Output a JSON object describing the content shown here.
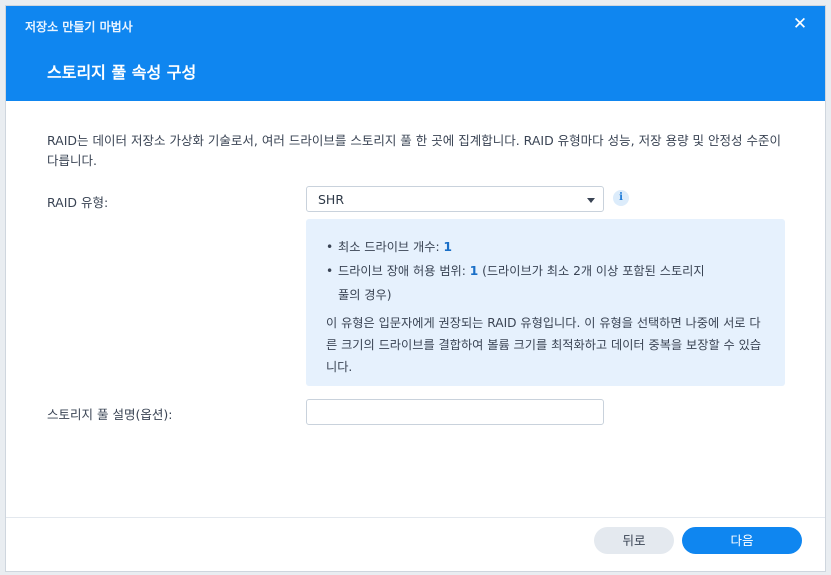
{
  "window": {
    "title": "저장소 만들기 마법사",
    "close_icon": "close-icon"
  },
  "header": {
    "step_title": "스토리지 풀 속성 구성"
  },
  "description": "RAID는 데이터 저장소 가상화 기술로서, 여러 드라이브를 스토리지 풀 한 곳에 집계합니다. RAID 유형마다 성능, 저장 용량 및 안정성 수준이 다릅니다.",
  "raid_type": {
    "label": "RAID 유형:",
    "selected": "SHR",
    "info_icon": "info-icon"
  },
  "info": {
    "min_drives_label": "최소 드라이브 개수: ",
    "min_drives_value": "1",
    "fault_tolerance_label": "드라이브 장애 허용 범위: ",
    "fault_tolerance_value": "1",
    "fault_tolerance_note_line1": " (드라이브가 최소 2개 이상 포함된 스토리지",
    "fault_tolerance_note_line2": "풀의 경우)",
    "paragraph": "이 유형은 입문자에게 권장되는 RAID 유형입니다. 이 유형을 선택하면 나중에 서로 다른 크기의 드라이브를 결합하여 볼륨 크기를 최적화하고 데이터 중복을 보장할 수 있습니다."
  },
  "pool_description": {
    "label": "스토리지 풀 설명(옵션):",
    "value": "",
    "placeholder": ""
  },
  "footer": {
    "back_label": "뒤로",
    "next_label": "다음"
  },
  "colors": {
    "accent": "#0f86f0",
    "info_bg": "#e6f1fd",
    "number_highlight": "#1a6fc7"
  }
}
